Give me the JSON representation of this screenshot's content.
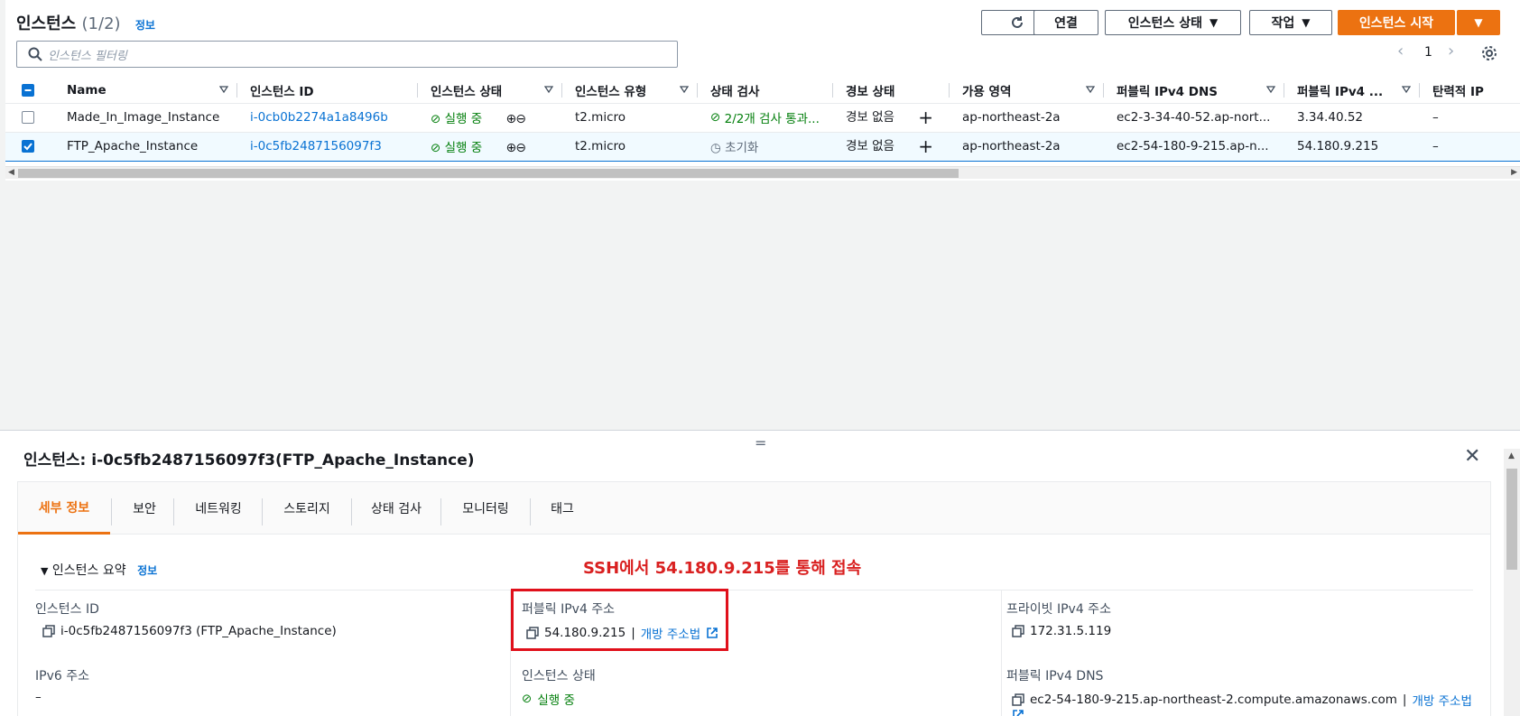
{
  "header": {
    "title": "인스턴스",
    "count": "(1/2)",
    "info": "정보",
    "buttons": {
      "connect": "연결",
      "instance_state": "인스턴스 상태",
      "actions": "작업",
      "launch": "인스턴스 시작"
    },
    "search_placeholder": "인스턴스 필터링",
    "page": "1"
  },
  "table": {
    "columns": [
      "Name",
      "인스턴스 ID",
      "인스턴스 상태",
      "인스턴스 유형",
      "상태 검사",
      "경보 상태",
      "가용 영역",
      "퍼블릭 IPv4 DNS",
      "퍼블릭 IPv4 ...",
      "탄력적 IP"
    ],
    "rows": [
      {
        "name": "Made_In_Image_Instance",
        "id": "i-0cb0b2274a1a8496b",
        "state": "실행 중",
        "type": "t2.micro",
        "check": "2/2개 검사 통과...",
        "alarm": "경보 없음",
        "az": "ap-northeast-2a",
        "dns": "ec2-3-34-40-52.ap-nort...",
        "ip": "3.34.40.52",
        "eip": "–",
        "selected": false
      },
      {
        "name": "FTP_Apache_Instance",
        "id": "i-0c5fb2487156097f3",
        "state": "실행 중",
        "type": "t2.micro",
        "check": "초기화",
        "alarm": "경보 없음",
        "az": "ap-northeast-2a",
        "dns": "ec2-54-180-9-215.ap-n...",
        "ip": "54.180.9.215",
        "eip": "–",
        "selected": true
      }
    ]
  },
  "detail": {
    "title": "인스턴스: i-0c5fb2487156097f3(FTP_Apache_Instance)",
    "tabs": [
      "세부 정보",
      "보안",
      "네트워킹",
      "스토리지",
      "상태 검사",
      "모니터링",
      "태그"
    ],
    "summary_label": "인스턴스 요약",
    "summary_info": "정보",
    "annotation": "SSH에서 54.180.9.215를 통해 접속",
    "fields": {
      "instance_id_label": "인스턴스 ID",
      "instance_id_value": "i-0c5fb2487156097f3 (FTP_Apache_Instance)",
      "public_ip_label": "퍼블릭 IPv4 주소",
      "public_ip_value": "54.180.9.215",
      "public_ip_sep": "|",
      "open_address": "개방 주소법",
      "private_ip_label": "프라이빗 IPv4 주소",
      "private_ip_value": "172.31.5.119",
      "ipv6_label": "IPv6 주소",
      "ipv6_value": "–",
      "state_label": "인스턴스 상태",
      "state_value": "실행 중",
      "public_dns_label": "퍼블릭 IPv4 DNS",
      "public_dns_value": "ec2-54-180-9-215.ap-northeast-2.compute.amazonaws.com",
      "public_dns_sep": "|",
      "public_dns_open": "개방 주소법"
    }
  },
  "colors": {
    "accent": "#ec7211",
    "link": "#0972d3",
    "success": "#037f0c",
    "annotation": "#d92020"
  }
}
